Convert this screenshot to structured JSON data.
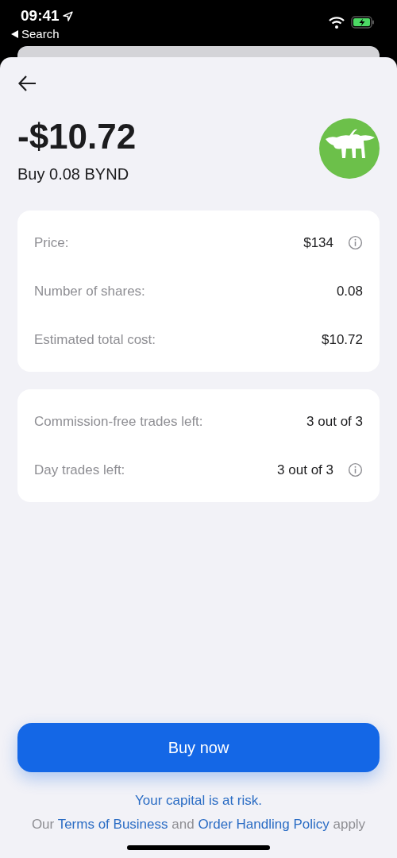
{
  "status_bar": {
    "time": "09:41",
    "back_label": "Search"
  },
  "header": {
    "amount": "-$10.72",
    "subtitle": "Buy 0.08 BYND"
  },
  "cards": [
    {
      "rows": [
        {
          "label": "Price:",
          "value": "$134",
          "info": true
        },
        {
          "label": "Number of shares:",
          "value": "0.08",
          "info": false
        },
        {
          "label": "Estimated total cost:",
          "value": "$10.72",
          "info": false
        }
      ]
    },
    {
      "rows": [
        {
          "label": "Commission-free trades left:",
          "value": "3 out of 3",
          "info": false
        },
        {
          "label": "Day trades left:",
          "value": "3 out of 3",
          "info": true
        }
      ]
    }
  ],
  "button": "Buy now",
  "footer": {
    "risk": "Your capital is at risk.",
    "parts": [
      {
        "kind": "text",
        "text": "Our"
      },
      {
        "kind": "link",
        "text": "Terms of Business"
      },
      {
        "kind": "text",
        "text": "and"
      },
      {
        "kind": "link",
        "text": "Order Handling Policy"
      },
      {
        "kind": "text",
        "text": "apply"
      }
    ]
  }
}
